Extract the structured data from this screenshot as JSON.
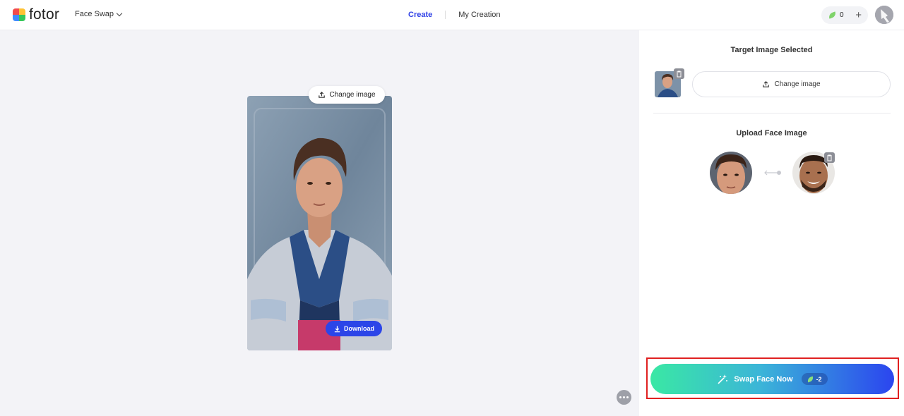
{
  "header": {
    "logo_text": "fotor",
    "logo_colors": [
      "#f24b4b",
      "#ffc233",
      "#3f8cff",
      "#35c759"
    ],
    "tool_select": "Face Swap",
    "nav": {
      "create": "Create",
      "my_creation": "My Creation"
    },
    "credits": "0",
    "accent": "#2f40e6"
  },
  "canvas": {
    "change_image": "Change image",
    "download": "Download"
  },
  "panel": {
    "target_title": "Target Image Selected",
    "change_image": "Change image",
    "face_title": "Upload Face Image",
    "swap_button": "Swap Face Now",
    "swap_cost": "-2"
  },
  "icons": [
    "leaf-icon",
    "plus-icon",
    "upload-icon",
    "download-icon",
    "trash-icon",
    "magic-wand-icon",
    "more-icon",
    "chevron-down-icon",
    "swap-arrow-icon"
  ]
}
